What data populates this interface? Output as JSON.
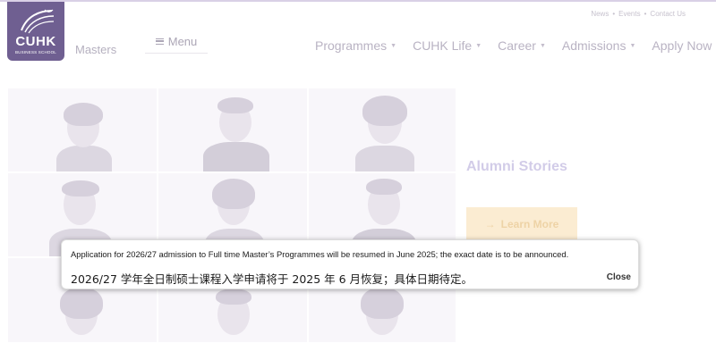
{
  "logo": {
    "name": "CUHK",
    "subtitle": "BUSINESS SCHOOL",
    "color": "#6f5f91"
  },
  "header": {
    "site_label": "Masters",
    "menu_label": "Menu",
    "utility_links": [
      "News",
      "Events",
      "Contact Us"
    ],
    "nav_items": [
      {
        "label": "Programmes",
        "dropdown": true
      },
      {
        "label": "CUHK Life",
        "dropdown": true
      },
      {
        "label": "Career",
        "dropdown": true
      },
      {
        "label": "Admissions",
        "dropdown": true
      },
      {
        "label": "Apply Now",
        "dropdown": false
      }
    ]
  },
  "hero": {
    "heading": "Alumni Stories",
    "button_label": "Learn More",
    "button_icon": "arrow-right-icon",
    "accent": "#fbecd2"
  },
  "notice": {
    "english": "Application for 2026/27 admission to Full time Master’s Programmes will be resumed in June 2025; the exact date is to be announced.",
    "chinese": "2026/27 学年全日制硕士课程入学申请将于 2025 年 6 月恢复；具体日期待定。",
    "close_label": "Close"
  }
}
